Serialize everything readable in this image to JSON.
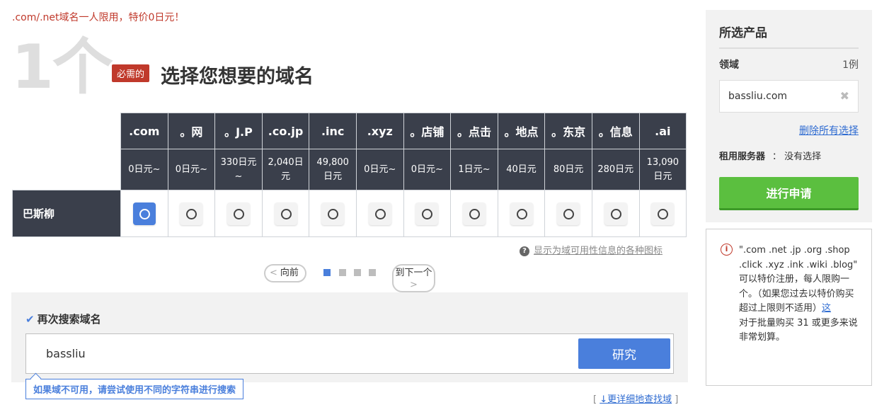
{
  "promo": ".com/.net域名一人限用，特价0日元！",
  "step": {
    "number": "1个",
    "badge": "必需的",
    "title": "选择您想要的域名"
  },
  "table": {
    "extensions": [
      ".com",
      "。网",
      "。J.P",
      ".co.jp",
      ".inc",
      ".xyz",
      "。店铺",
      "。点击",
      "。地点",
      "。东京",
      "。信息",
      ".ai"
    ],
    "prices": [
      "0日元~",
      "0日元~",
      "330日元~",
      "2,040日元",
      "49,800 日元",
      "0日元~",
      "0日元~",
      "1日元~",
      "40日元",
      "80日元",
      "280日元",
      "13,090 日元"
    ],
    "row_label": "巴斯柳",
    "selected": [
      true,
      false,
      false,
      false,
      false,
      false,
      false,
      false,
      false,
      false,
      false,
      false
    ]
  },
  "icons_help": "显示为域可用性信息的各种图标",
  "pager": {
    "prev": "向前",
    "next": "到下一个",
    "pages": 4,
    "current": 0
  },
  "research": {
    "title": "再次搜索域名",
    "value": "bassliu",
    "button": "研究",
    "tooltip": "如果域不可用，请尝试使用不同的字符串进行搜索",
    "detail_link": "↓更详细地查找域"
  },
  "side": {
    "title": "所选产品",
    "domain_label": "领域",
    "domain_count": "1例",
    "selected_domain": "bassliu.com",
    "delete_all": "删除所有选择",
    "server_label": "租用服务器",
    "server_sep": "：",
    "server_value": "没有选择",
    "apply": "进行申请"
  },
  "notice": {
    "text": "\".com .net .jp .org .shop .click .xyz .ink .wiki .blog\" 可以特价注册，每人限购一个。（如果您过去以特价购买超过上限则不适用）",
    "link": "这",
    "text2": "对于批量购买 31 或更多来说非常划算。"
  },
  "colors": {
    "accent": "#4a7fdc",
    "header_bg": "#3a3f4b",
    "apply_green": "#5bbf3f",
    "promo_red": "#c0392b"
  }
}
